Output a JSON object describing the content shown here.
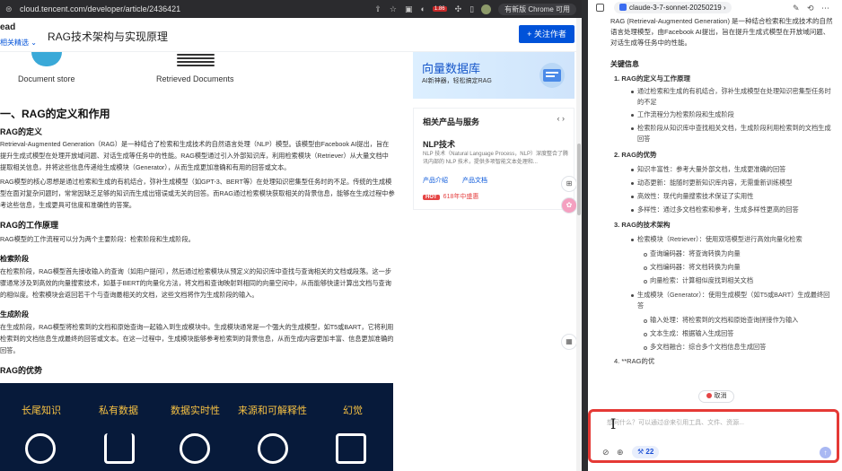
{
  "browser": {
    "url": "cloud.tencent.com/developer/article/2436421",
    "update_label": "有新版 Chrome 可用",
    "ext_badge": "1.86"
  },
  "page": {
    "brand": "ead",
    "crumb": "相关精选 ⌄",
    "title": "RAG技术架构与实现原理",
    "follow_label": "+ 关注作者"
  },
  "article": {
    "doc_store_label": "Document store",
    "retrieved_label": "Retrieved Documents",
    "h1": "一、RAG的定义和作用",
    "sec1_title": "RAG的定义",
    "sec1_p1": "Retrieval-Augmented Generation（RAG）是一种结合了检索和生成技术的自然语言处理（NLP）模型。该模型由Facebook AI提出，旨在提升生成式模型在处理开放域问题、对话生成等任务中的性能。RAG模型通过引入外部知识库，利用检索模块（Retriever）从大量文档中提取相关信息，并将这些信息传递给生成模块（Generator），从而生成更加准确和有用的回答或文本。",
    "sec1_p2": "RAG模型的核心思想是通过检索和生成的有机结合，弥补生成模型（如GPT-3、BERT等）在处理知识密集型任务时的不足。传统的生成模型在面对复杂问题时，常常因缺乏足够的知识而生成出错误或无关的回答。而RAG通过检索模块获取相关的背景信息，能够在生成过程中参考这些信息，生成更具可信度和准确性的答案。",
    "sec2_title": "RAG的工作原理",
    "sec2_p": "RAG模型的工作流程可以分为两个主要阶段：检索阶段和生成阶段。",
    "sub1_title": "检索阶段",
    "sub1_p": "在检索阶段，RAG模型首先接收输入的查询（如用户提问），然后通过检索模块从预定义的知识库中查找与查询相关的文档或段落。这一步骤通常涉及到高效的向量搜索技术，如基于BERT的向量化方法，将文档和查询映射到相同的向量空间中，从而能够快速计算出文档与查询的相似度。检索模块会返回若干个与查询最相关的文档，这些文档将作为生成阶段的输入。",
    "sub2_title": "生成阶段",
    "sub2_p": "在生成阶段，RAG模型将检索到的文档和原始查询一起输入到生成模块中。生成模块通常是一个强大的生成模型，如T5或BART，它将利用检索到的文档信息生成最终的回答或文本。在这一过程中，生成模块能够参考检索到的背景信息，从而生成内容更加丰富、信息更加准确的回答。",
    "sec3_title": "RAG的优势",
    "infographic": [
      "长尾知识",
      "私有数据",
      "数据实时性",
      "来源和可解释性",
      "幻觉"
    ]
  },
  "sidebar": {
    "banner_title": "向量数据库",
    "banner_sub": "AI新神器，轻松搞定RAG",
    "card_title": "相关产品与服务",
    "card_nav": "‹  ›",
    "product_name": "NLP技术",
    "product_desc": "NLP 技术（Natural Language Process，NLP）深度整合了腾讯内部的 NLP 技术，提供多项智能文本处理和...",
    "link_intro": "产品介绍",
    "link_docs": "产品文档",
    "promo_badge": "HOT",
    "promo_text": "618年中盛惠"
  },
  "panel": {
    "model_name": "claude-3-7-sonnet-20250219",
    "intro": "RAG (Retrieval-Augmented Generation) 是一种结合检索和生成技术的自然语言处理模型，由Facebook AI提出，旨在提升生成式模型在开放域问题、对话生成等任务中的性能。",
    "key_heading": "关键信息",
    "s1_title": "1.  RAG的定义与工作原理",
    "s1_items": [
      "通过检索和生成的有机结合，弥补生成模型在处理知识密集型任务时的不足",
      "工作流程分为检索阶段和生成阶段",
      "检索阶段从知识库中查找相关文档，生成阶段利用检索到的文档生成回答"
    ],
    "s2_title": "2.  RAG的优势",
    "s2_items": [
      "知识丰富性：参考大量外部文档，生成更准确的回答",
      "动态更新：能随时更新知识库内容，无需重新训练模型",
      "高效性：现代向量搜索技术保证了实用性",
      "多样性：通过多文档检索和参考，生成多样性更高的回答"
    ],
    "s3_title": "3.  RAG的技术架构",
    "s3_retriever": "检索模块（Retriever）：使用双塔模型进行高效向量化检索",
    "s3_retriever_subs": [
      "查询编码器：将查询转换为向量",
      "文档编码器：将文档转换为向量",
      "向量检索：计算相似度找到相关文档"
    ],
    "s3_generator": "生成模块（Generator）：使用生成模型（如T5或BART）生成最终回答",
    "s3_generator_subs": [
      "输入处理：将检索到的文档和原始查询拼接作为输入",
      "文本生成：根据输入生成回答",
      "多文档融合：综合多个文档信息生成回答"
    ],
    "s4_title": "4.  **RAG的优",
    "cancel_label": "取消",
    "input_placeholder": "想问什么？可以通过@来引用工具、文件、资源...",
    "tools_count": "22"
  }
}
